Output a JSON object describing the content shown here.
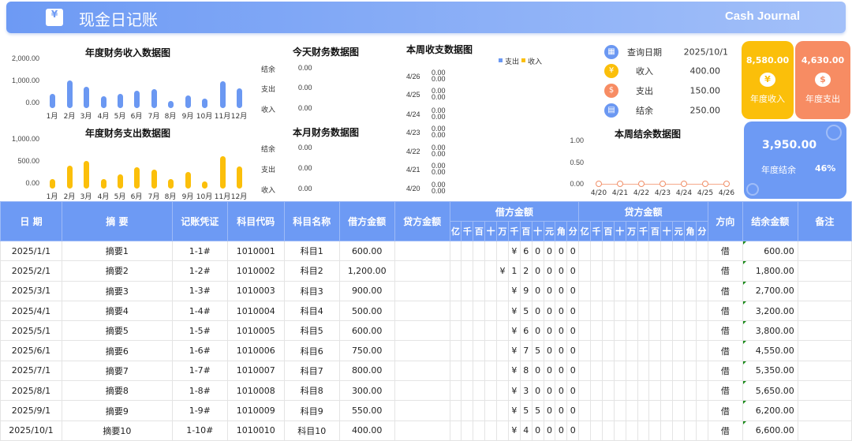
{
  "header": {
    "title": "现金日记账",
    "subtitle": "Cash Journal",
    "icon": "cash-receipt-icon"
  },
  "colors": {
    "income": "#6b98f2",
    "expense": "#fbbf0a",
    "orange": "#f78c63",
    "header": "#6d9af4"
  },
  "income_chart": {
    "title": "年度财务收入数据图",
    "ticks": [
      "2,000.00",
      "1,000.00",
      "0.00"
    ],
    "ylim": [
      0,
      2000
    ],
    "months": [
      "1月",
      "2月",
      "3月",
      "4月",
      "5月",
      "6月",
      "7月",
      "8月",
      "9月",
      "10月",
      "11月",
      "12月"
    ],
    "values": [
      600,
      1200,
      900,
      500,
      600,
      750,
      800,
      300,
      550,
      400,
      1150,
      850
    ]
  },
  "expense_chart": {
    "title": "年度财务支出数据图",
    "ticks": [
      "1,000.00",
      "500.00",
      "0.00"
    ],
    "ylim": [
      0,
      1000
    ],
    "months": [
      "1月",
      "2月",
      "3月",
      "4月",
      "5月",
      "6月",
      "7月",
      "8月",
      "9月",
      "10月",
      "11月",
      "12月"
    ],
    "values": [
      200,
      500,
      600,
      200,
      300,
      450,
      400,
      200,
      350,
      150,
      700,
      480
    ]
  },
  "today": {
    "title": "今天财务数据图",
    "rows": [
      {
        "label": "结余",
        "value": "0.00"
      },
      {
        "label": "支出",
        "value": "0.00"
      },
      {
        "label": "收入",
        "value": "0.00"
      }
    ]
  },
  "month": {
    "title": "本月财务数据图",
    "rows": [
      {
        "label": "结余",
        "value": "0.00"
      },
      {
        "label": "支出",
        "value": "0.00"
      },
      {
        "label": "收入",
        "value": "0.00"
      }
    ]
  },
  "week": {
    "title": "本周收支数据图",
    "legend": [
      "支出",
      "收入"
    ],
    "rows": [
      {
        "date": "4/26",
        "a": "0.00",
        "b": "0.00"
      },
      {
        "date": "4/25",
        "a": "0.00",
        "b": "0.00"
      },
      {
        "date": "4/24",
        "a": "0.00",
        "b": "0.00"
      },
      {
        "date": "4/23",
        "a": "0.00",
        "b": "0.00"
      },
      {
        "date": "4/22",
        "a": "0.00",
        "b": "0.00"
      },
      {
        "date": "4/21",
        "a": "0.00",
        "b": "0.00"
      },
      {
        "date": "4/20",
        "a": "0.00",
        "b": "0.00"
      }
    ]
  },
  "info": [
    {
      "icon": "calendar-icon",
      "glyph": "▦",
      "color": "#6b98f2",
      "label": "查询日期",
      "value": "2025/10/1"
    },
    {
      "icon": "yen-icon",
      "glyph": "¥",
      "color": "#fbbf0a",
      "label": "收入",
      "value": "400.00"
    },
    {
      "icon": "dollar-icon",
      "glyph": "$",
      "color": "#f78c63",
      "label": "支出",
      "value": "150.00"
    },
    {
      "icon": "note-icon",
      "glyph": "▤",
      "color": "#6b98f2",
      "label": "结余",
      "value": "250.00"
    }
  ],
  "week_balance": {
    "title": "本周结余数据图",
    "ticks": [
      "1.00",
      "0.50",
      "0.00"
    ],
    "ylim": [
      0,
      1
    ],
    "dates": [
      "4/20",
      "4/21",
      "4/22",
      "4/23",
      "4/24",
      "4/25",
      "4/26"
    ],
    "values": [
      0,
      0,
      0,
      0,
      0,
      0,
      0
    ]
  },
  "cards": {
    "income": {
      "value": "8,580.00",
      "label": "年度收入",
      "glyph": "¥"
    },
    "expense": {
      "value": "4,630.00",
      "label": "年度支出",
      "glyph": "$"
    },
    "balance": {
      "value": "3,950.00",
      "label": "年度结余",
      "percent": "46%"
    }
  },
  "table": {
    "headers": [
      "日  期",
      "摘  要",
      "记账凭证",
      "科目代码",
      "科目名称",
      "借方金额",
      "贷方金额",
      "借方金额",
      "贷方金额",
      "方向",
      "结余金额",
      "备注"
    ],
    "digits": [
      "亿",
      "千",
      "百",
      "十",
      "万",
      "千",
      "百",
      "十",
      "元",
      "角",
      "分"
    ],
    "rows": [
      {
        "date": "2025/1/1",
        "summary": "摘要1",
        "voucher": "1-1#",
        "code": "1010001",
        "name": "科目1",
        "debit": "600.00",
        "credit": "",
        "dd": [
          "",
          "",
          "",
          "",
          "",
          "¥",
          "6",
          "0",
          "0",
          "0",
          "0"
        ],
        "dir": "借",
        "balance": "600.00",
        "note": ""
      },
      {
        "date": "2025/2/1",
        "summary": "摘要2",
        "voucher": "1-2#",
        "code": "1010002",
        "name": "科目2",
        "debit": "1,200.00",
        "credit": "",
        "dd": [
          "",
          "",
          "",
          "",
          "¥",
          "1",
          "2",
          "0",
          "0",
          "0",
          "0"
        ],
        "dir": "借",
        "balance": "1,800.00",
        "note": ""
      },
      {
        "date": "2025/3/1",
        "summary": "摘要3",
        "voucher": "1-3#",
        "code": "1010003",
        "name": "科目3",
        "debit": "900.00",
        "credit": "",
        "dd": [
          "",
          "",
          "",
          "",
          "",
          "¥",
          "9",
          "0",
          "0",
          "0",
          "0"
        ],
        "dir": "借",
        "balance": "2,700.00",
        "note": ""
      },
      {
        "date": "2025/4/1",
        "summary": "摘要4",
        "voucher": "1-4#",
        "code": "1010004",
        "name": "科目4",
        "debit": "500.00",
        "credit": "",
        "dd": [
          "",
          "",
          "",
          "",
          "",
          "¥",
          "5",
          "0",
          "0",
          "0",
          "0"
        ],
        "dir": "借",
        "balance": "3,200.00",
        "note": ""
      },
      {
        "date": "2025/5/1",
        "summary": "摘要5",
        "voucher": "1-5#",
        "code": "1010005",
        "name": "科目5",
        "debit": "600.00",
        "credit": "",
        "dd": [
          "",
          "",
          "",
          "",
          "",
          "¥",
          "6",
          "0",
          "0",
          "0",
          "0"
        ],
        "dir": "借",
        "balance": "3,800.00",
        "note": ""
      },
      {
        "date": "2025/6/1",
        "summary": "摘要6",
        "voucher": "1-6#",
        "code": "1010006",
        "name": "科目6",
        "debit": "750.00",
        "credit": "",
        "dd": [
          "",
          "",
          "",
          "",
          "",
          "¥",
          "7",
          "5",
          "0",
          "0",
          "0"
        ],
        "dir": "借",
        "balance": "4,550.00",
        "note": ""
      },
      {
        "date": "2025/7/1",
        "summary": "摘要7",
        "voucher": "1-7#",
        "code": "1010007",
        "name": "科目7",
        "debit": "800.00",
        "credit": "",
        "dd": [
          "",
          "",
          "",
          "",
          "",
          "¥",
          "8",
          "0",
          "0",
          "0",
          "0"
        ],
        "dir": "借",
        "balance": "5,350.00",
        "note": ""
      },
      {
        "date": "2025/8/1",
        "summary": "摘要8",
        "voucher": "1-8#",
        "code": "1010008",
        "name": "科目8",
        "debit": "300.00",
        "credit": "",
        "dd": [
          "",
          "",
          "",
          "",
          "",
          "¥",
          "3",
          "0",
          "0",
          "0",
          "0"
        ],
        "dir": "借",
        "balance": "5,650.00",
        "note": ""
      },
      {
        "date": "2025/9/1",
        "summary": "摘要9",
        "voucher": "1-9#",
        "code": "1010009",
        "name": "科目9",
        "debit": "550.00",
        "credit": "",
        "dd": [
          "",
          "",
          "",
          "",
          "",
          "¥",
          "5",
          "5",
          "0",
          "0",
          "0"
        ],
        "dir": "借",
        "balance": "6,200.00",
        "note": ""
      },
      {
        "date": "2025/10/1",
        "summary": "摘要10",
        "voucher": "1-10#",
        "code": "1010010",
        "name": "科目10",
        "debit": "400.00",
        "credit": "",
        "dd": [
          "",
          "",
          "",
          "",
          "",
          "¥",
          "4",
          "0",
          "0",
          "0",
          "0"
        ],
        "dir": "借",
        "balance": "6,600.00",
        "note": ""
      }
    ]
  }
}
